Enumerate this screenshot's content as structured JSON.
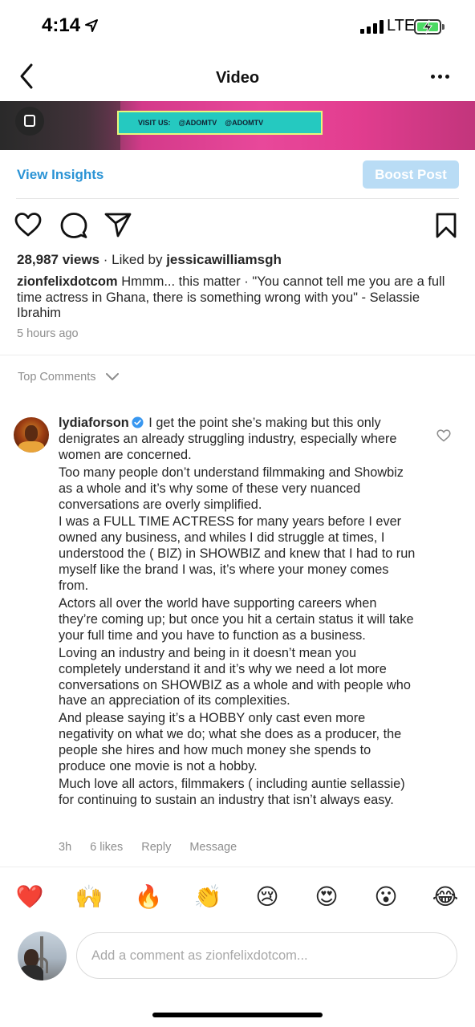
{
  "status_bar": {
    "time": "4:14",
    "network": "LTE",
    "battery_charging": true,
    "colors": {
      "battery": "#4cd964"
    }
  },
  "nav": {
    "title": "Video",
    "icons": {
      "back": "chevron-left-icon",
      "more": "more-horizontal-icon"
    }
  },
  "video": {
    "banner_visit": "VISIT US:",
    "banner_facebook": "@ADOMTV",
    "banner_instagram": "@ADOMTV"
  },
  "insights": {
    "view_insights_label": "View Insights",
    "boost_post_label": "Boost Post",
    "colors": {
      "link": "#2a93d5",
      "boost_disabled": "#b9dcf5"
    }
  },
  "actions": {
    "icons": [
      "heart-icon",
      "comment-icon",
      "share-icon",
      "bookmark-icon"
    ]
  },
  "post": {
    "views": "28,987 views",
    "liked_by_prefix": "· Liked by",
    "liked_by_user": "jessicawilliamsgh",
    "caption_user": "zionfelixdotcom",
    "caption_text": "Hmmm... this matter · \"You cannot tell me you are a full time actress in Ghana, there is something wrong with you\" - Selassie Ibrahim",
    "time_ago": "5 hours ago"
  },
  "comments_header": {
    "label": "Top Comments"
  },
  "comment": {
    "username": "lydiaforson",
    "verified": true,
    "paragraphs": [
      "I get the point she’s making but this only denigrates an already struggling industry, especially where women are concerned.",
      "Too many people don’t understand filmmaking and Showbiz as a whole and it’s why some of these very nuanced conversations are overly simplified.",
      "I was a FULL TIME ACTRESS for many years before I ever owned any business, and whiles I did struggle at times, I understood the ( BIZ) in SHOWBIZ and knew that I had to run myself like the brand I was, it’s where your money comes from.",
      "Actors all over the world have supporting careers when they’re coming up; but once you hit a certain status it will take your full time and you have to function as a business.",
      "Loving an industry and being in it doesn’t mean you completely understand it and it’s why we need a lot more conversations on SHOWBIZ as a whole and with people who have an appreciation of its complexities.",
      "And please saying it’s a HOBBY only cast even more negativity on what we do; what she does as a producer, the people she hires and how much money she spends to produce one movie is not a hobby.",
      "Much love all actors, filmmakers ( including auntie sellassie) for continuing to sustain an industry that isn’t always easy."
    ],
    "time": "3h",
    "likes": "6 likes",
    "reply_label": "Reply",
    "message_label": "Message"
  },
  "emoji_bar": [
    "❤️",
    "🙌",
    "🔥",
    "👏",
    "😢",
    "😍",
    "😮",
    "😂"
  ],
  "comment_input": {
    "placeholder": "Add a comment as zionfelixdotcom..."
  }
}
